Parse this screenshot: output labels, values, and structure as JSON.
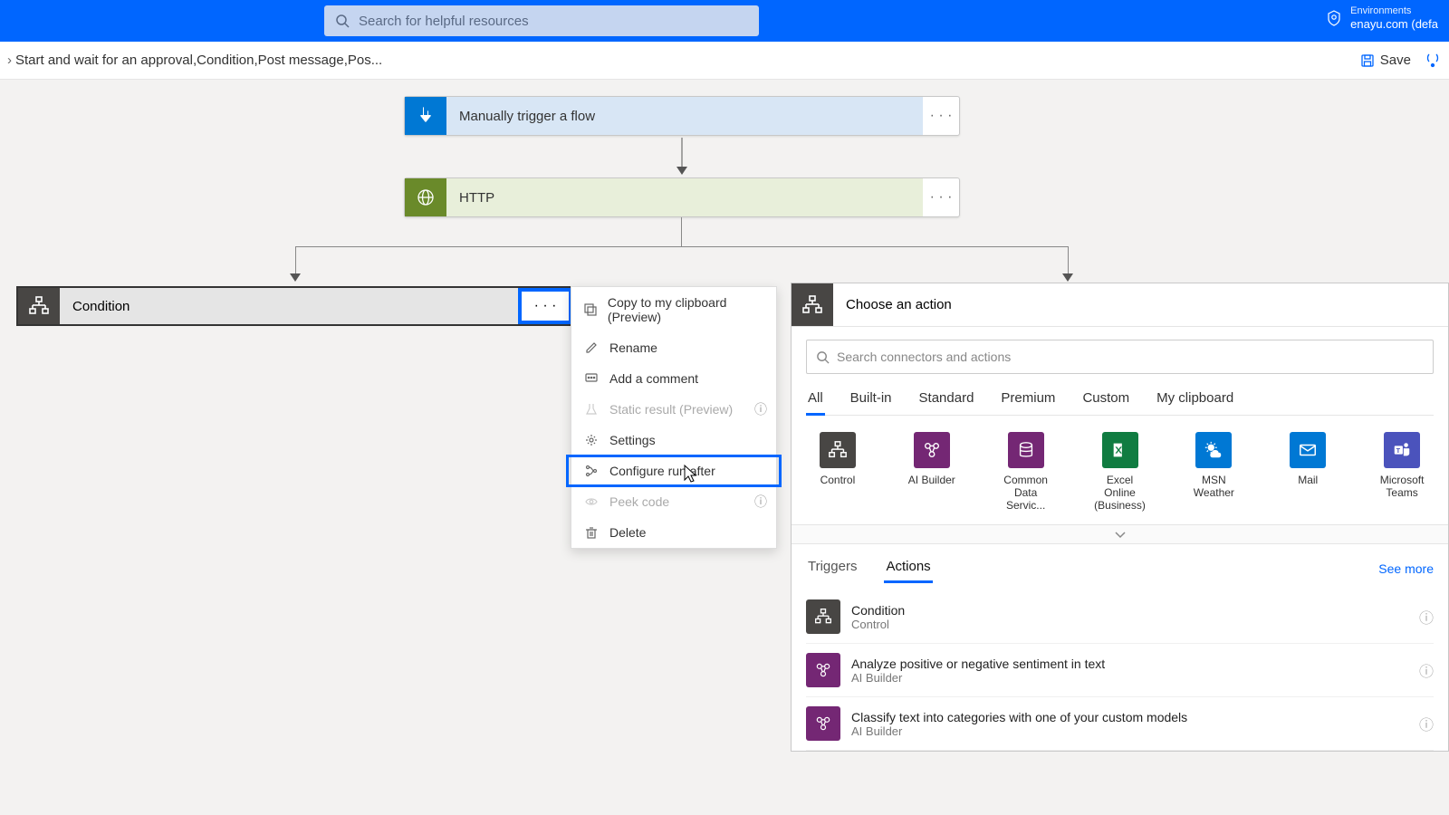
{
  "header": {
    "search_placeholder": "Search for helpful resources",
    "env_label": "Environments",
    "env_name": "enayu.com (defa"
  },
  "toolbar": {
    "breadcrumb": "Start and wait for an approval,Condition,Post message,Pos...",
    "save": "Save"
  },
  "flow": {
    "trigger": "Manually trigger a flow",
    "http": "HTTP",
    "condition": "Condition"
  },
  "menu": {
    "copy": "Copy to my clipboard (Preview)",
    "rename": "Rename",
    "comment": "Add a comment",
    "static": "Static result (Preview)",
    "settings": "Settings",
    "configure": "Configure run after",
    "peek": "Peek code",
    "delete": "Delete"
  },
  "panel": {
    "title": "Choose an action",
    "search_placeholder": "Search connectors and actions",
    "tabs": [
      "All",
      "Built-in",
      "Standard",
      "Premium",
      "Custom",
      "My clipboard"
    ],
    "connectors": [
      {
        "name": "Control",
        "color": "#484644"
      },
      {
        "name": "AI Builder",
        "color": "#742774"
      },
      {
        "name": "Common Data Servic...",
        "color": "#742774"
      },
      {
        "name": "Excel Online (Business)",
        "color": "#107c41"
      },
      {
        "name": "MSN Weather",
        "color": "#0078d4"
      },
      {
        "name": "Mail",
        "color": "#0078d4"
      },
      {
        "name": "Microsoft Teams",
        "color": "#4b53bc"
      }
    ],
    "subtabs": {
      "triggers": "Triggers",
      "actions": "Actions"
    },
    "see_more": "See more",
    "actions": [
      {
        "title": "Condition",
        "sub": "Control",
        "color": "#484644",
        "icon": "control"
      },
      {
        "title": "Analyze positive or negative sentiment in text",
        "sub": "AI Builder",
        "color": "#742774",
        "icon": "ai"
      },
      {
        "title": "Classify text into categories with one of your custom models",
        "sub": "AI Builder",
        "color": "#742774",
        "icon": "ai"
      }
    ]
  }
}
